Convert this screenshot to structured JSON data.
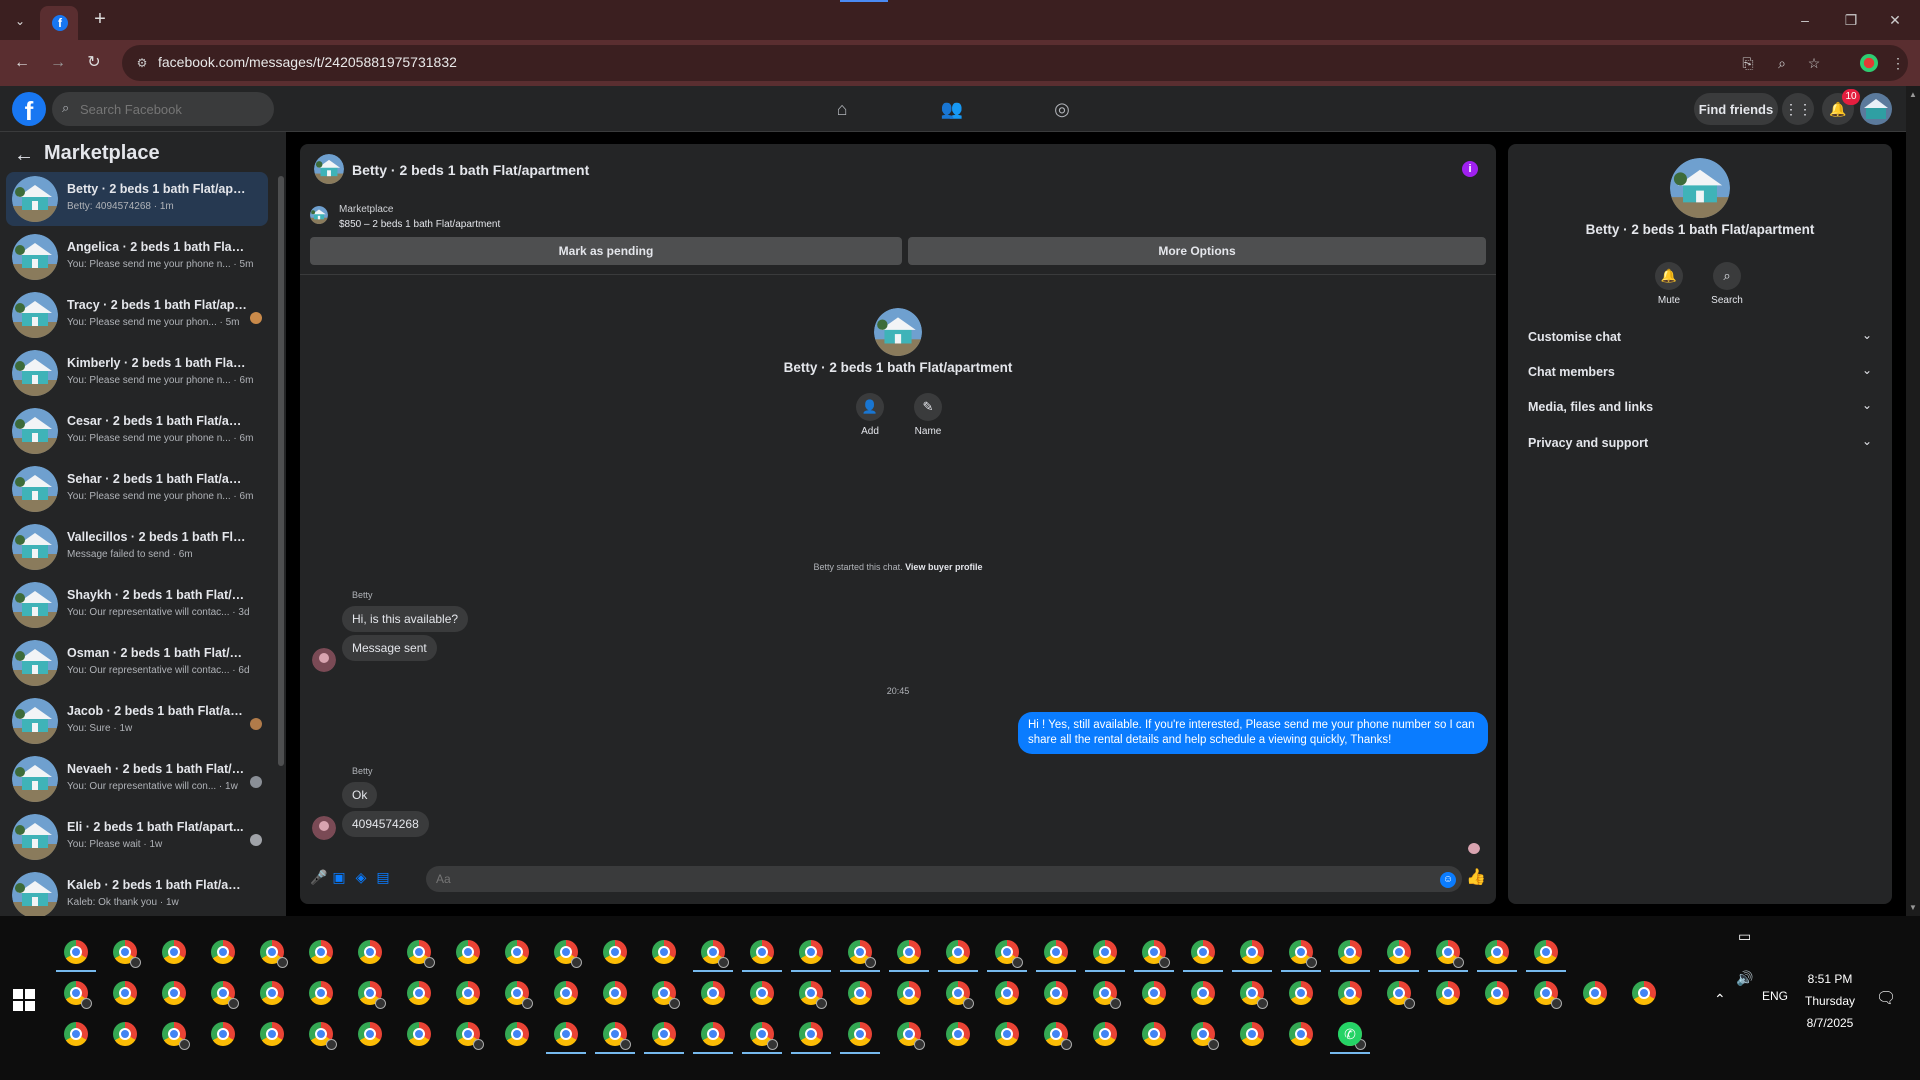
{
  "browser": {
    "url": "facebook.com/messages/t/24205881975731832",
    "tab_title": "Facebook"
  },
  "fb": {
    "search_placeholder": "Search Facebook",
    "find_friends": "Find friends",
    "notifications_count": "10"
  },
  "sidebar": {
    "title": "Marketplace",
    "conversations": [
      {
        "name": "Betty · 2 beds 1 bath Flat/apart...",
        "snippet": "Betty: 4094574268 · 1m"
      },
      {
        "name": "Angelica · 2 beds 1 bath Flat/ap...",
        "snippet": "You: Please send me your phone n... · 5m"
      },
      {
        "name": "Tracy · 2 beds 1 bath Flat/apa...",
        "snippet": "You: Please send me your phon... · 5m"
      },
      {
        "name": "Kimberly · 2 beds 1 bath Flat/ap...",
        "snippet": "You: Please send me your phone n... · 6m"
      },
      {
        "name": "Cesar · 2 beds 1 bath Flat/apart...",
        "snippet": "You: Please send me your phone n... · 6m"
      },
      {
        "name": "Sehar · 2 beds 1 bath Flat/apart...",
        "snippet": "You: Please send me your phone n... · 6m"
      },
      {
        "name": "Vallecillos · 2 beds 1 bath Flat/a...",
        "snippet": "Message failed to send · 6m"
      },
      {
        "name": "Shaykh · 2 beds 1 bath Flat/apar...",
        "snippet": "You: Our representative will contac... · 3d"
      },
      {
        "name": "Osman · 2 beds 1 bath Flat/apar...",
        "snippet": "You: Our representative will contac... · 6d"
      },
      {
        "name": "Jacob · 2 beds 1 bath Flat/apa...",
        "snippet": "You: Sure · 1w"
      },
      {
        "name": "Nevaeh · 2 beds 1 bath Flat/a...",
        "snippet": "You: Our representative will con... · 1w"
      },
      {
        "name": "Eli · 2 beds 1 bath Flat/apart...",
        "snippet": "You: Please wait · 1w"
      },
      {
        "name": "Kaleb · 2 beds 1 bath Flat/apart...",
        "snippet": "Kaleb: Ok thank you · 1w"
      }
    ]
  },
  "chat": {
    "title": "Betty · 2 beds 1 bath Flat/apartment",
    "marketplace_label": "Marketplace",
    "listing": "$850 – 2 beds 1 bath Flat/apartment",
    "mark_pending": "Mark as pending",
    "more_options": "More Options",
    "intro_name": "Betty · 2 beds 1 bath Flat/apartment",
    "add_label": "Add",
    "name_label": "Name",
    "started_text": "Betty started this chat.",
    "view_profile": "View buyer profile",
    "sender_1": "Betty",
    "msg_1": "Hi, is this available?",
    "msg_2": "Message sent",
    "timestamp": "20:45",
    "my_msg": "Hi ! Yes, still available. If you're interested, Please send me your phone number so I can share all the rental details and help schedule a viewing quickly, Thanks!",
    "sender_2": "Betty",
    "msg_3": "Ok",
    "msg_4": "4094574268",
    "composer_placeholder": "Aa"
  },
  "details": {
    "name": "Betty · 2 beds 1 bath Flat/apartment",
    "mute": "Mute",
    "search": "Search",
    "sections": [
      "Customise chat",
      "Chat members",
      "Media, files and links",
      "Privacy and support"
    ]
  },
  "taskbar": {
    "time": "8:51 PM",
    "day": "Thursday",
    "date": "8/7/2025",
    "lang": "ENG"
  },
  "colors": {
    "accent_blue": "#0a7cff",
    "fb_blue": "#1877f2",
    "panel": "#242526"
  }
}
